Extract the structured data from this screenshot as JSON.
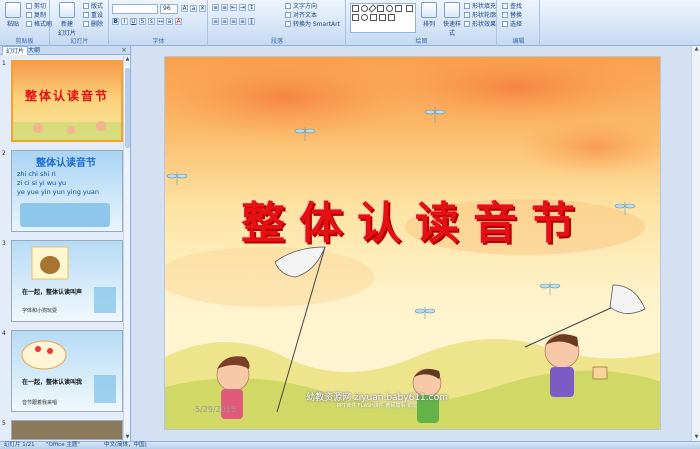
{
  "ribbon": {
    "clipboard": {
      "paste": "粘贴",
      "cut": "剪切",
      "copy": "复制",
      "format_painter": "格式刷",
      "label": "剪贴板"
    },
    "slides": {
      "new_slide": "新建\n幻灯片",
      "layout": "版式",
      "reset": "重设",
      "delete": "删除",
      "label": "幻灯片"
    },
    "font": {
      "font_name": "",
      "font_size": "96",
      "label": "字体"
    },
    "paragraph": {
      "text_direction": "文字方向",
      "align_text": "对齐文本",
      "smartart": "转换为 SmartArt",
      "label": "段落"
    },
    "drawing": {
      "arrange": "排列",
      "quick_styles": "快速样式",
      "shape_fill": "形状填充",
      "shape_outline": "形状轮廓",
      "shape_effects": "形状效果",
      "label": "绘图"
    },
    "editing": {
      "find": "查找",
      "replace": "替换",
      "select": "选择",
      "label": "编辑"
    }
  },
  "left_panel": {
    "tabs": [
      "幻灯片",
      "大纲"
    ],
    "close": "×",
    "thumbnails": [
      {
        "num": "1",
        "title": "整体认读音节"
      },
      {
        "num": "2",
        "title": "整体认读音节",
        "pinyin": [
          "zhi chi shi ri",
          "zi ci si yi wu yu",
          "ye yue yin yun ying yuan"
        ]
      },
      {
        "num": "3",
        "text": "在一起，整体认读叫声",
        "sub": "字体和小狗玩耍"
      },
      {
        "num": "4",
        "text": "在一起，整体认读叫我",
        "sub": "音节跟着我来唱"
      },
      {
        "num": "5"
      }
    ]
  },
  "slide": {
    "title": "整体认读音节",
    "date": "5/29/2015",
    "site": "幼教资源网 ziyuan.baby611.com",
    "site_sub": "PPT课件  FLASH课件  教师故事  论坛"
  },
  "status": {
    "slide_info": "幻灯片 1/21",
    "theme": "\"Office 主题\"",
    "language": "中文(简体，中国)"
  },
  "colors": {
    "ribbon": "#d6e5f7",
    "title_red": "#e60f12",
    "selection": "#f2a332"
  }
}
